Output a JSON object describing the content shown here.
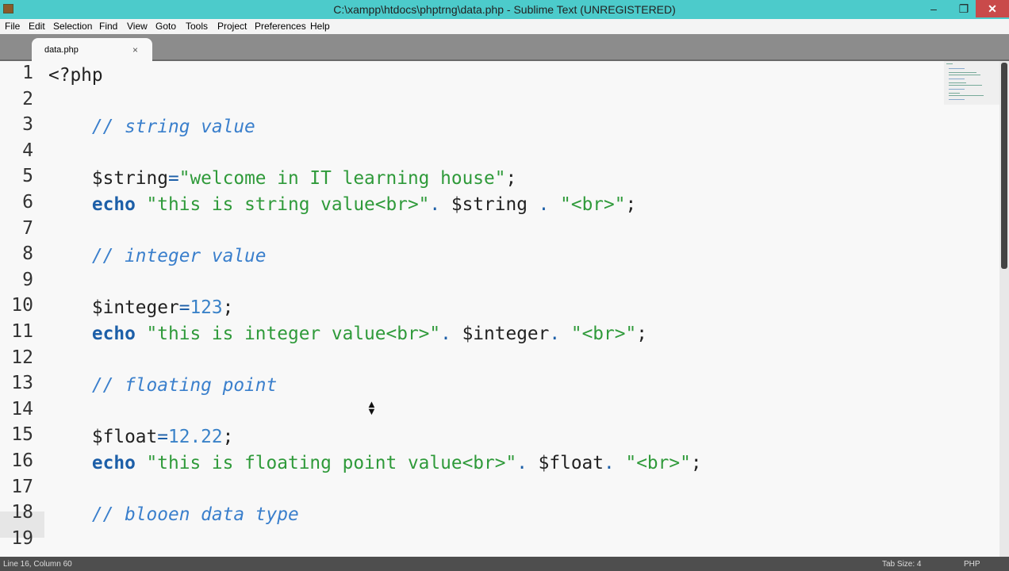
{
  "window": {
    "title": "C:\\xampp\\htdocs\\phptrng\\data.php - Sublime Text (UNREGISTERED)",
    "minimize": "–",
    "restore": "❐",
    "close": "✕"
  },
  "menu": [
    "File",
    "Edit",
    "Selection",
    "Find",
    "View",
    "Goto",
    "Tools",
    "Project",
    "Preferences",
    "Help"
  ],
  "tab": {
    "name": "data.php",
    "close": "×"
  },
  "code": [
    [
      {
        "t": "<?php",
        "c": "plain"
      }
    ],
    [],
    [
      {
        "t": "    ",
        "c": "plain"
      },
      {
        "t": "// string value",
        "c": "com"
      }
    ],
    [],
    [
      {
        "t": "    ",
        "c": "plain"
      },
      {
        "t": "$string",
        "c": "var"
      },
      {
        "t": "=",
        "c": "op"
      },
      {
        "t": "\"welcome in IT learning house\"",
        "c": "str"
      },
      {
        "t": ";",
        "c": "plain"
      }
    ],
    [
      {
        "t": "    ",
        "c": "plain"
      },
      {
        "t": "echo",
        "c": "kw"
      },
      {
        "t": " ",
        "c": "plain"
      },
      {
        "t": "\"this is string value<br>\"",
        "c": "str"
      },
      {
        "t": ". ",
        "c": "op"
      },
      {
        "t": "$string",
        "c": "var"
      },
      {
        "t": " . ",
        "c": "op"
      },
      {
        "t": "\"<br>\"",
        "c": "str"
      },
      {
        "t": ";",
        "c": "plain"
      }
    ],
    [],
    [
      {
        "t": "    ",
        "c": "plain"
      },
      {
        "t": "// integer value",
        "c": "com"
      }
    ],
    [],
    [
      {
        "t": "    ",
        "c": "plain"
      },
      {
        "t": "$integer",
        "c": "var"
      },
      {
        "t": "=",
        "c": "op"
      },
      {
        "t": "123",
        "c": "num"
      },
      {
        "t": ";",
        "c": "plain"
      }
    ],
    [
      {
        "t": "    ",
        "c": "plain"
      },
      {
        "t": "echo",
        "c": "kw"
      },
      {
        "t": " ",
        "c": "plain"
      },
      {
        "t": "\"this is integer value<br>\"",
        "c": "str"
      },
      {
        "t": ". ",
        "c": "op"
      },
      {
        "t": "$integer",
        "c": "var"
      },
      {
        "t": ". ",
        "c": "op"
      },
      {
        "t": "\"<br>\"",
        "c": "str"
      },
      {
        "t": ";",
        "c": "plain"
      }
    ],
    [],
    [
      {
        "t": "    ",
        "c": "plain"
      },
      {
        "t": "// floating point",
        "c": "com"
      }
    ],
    [],
    [
      {
        "t": "    ",
        "c": "plain"
      },
      {
        "t": "$float",
        "c": "var"
      },
      {
        "t": "=",
        "c": "op"
      },
      {
        "t": "12.22",
        "c": "num"
      },
      {
        "t": ";",
        "c": "plain"
      }
    ],
    [
      {
        "t": "    ",
        "c": "plain"
      },
      {
        "t": "echo",
        "c": "kw"
      },
      {
        "t": " ",
        "c": "plain"
      },
      {
        "t": "\"this is floating point value<br>\"",
        "c": "str"
      },
      {
        "t": ". ",
        "c": "op"
      },
      {
        "t": "$float",
        "c": "var"
      },
      {
        "t": ". ",
        "c": "op"
      },
      {
        "t": "\"<br>\"",
        "c": "str"
      },
      {
        "t": ";",
        "c": "plain"
      }
    ],
    [],
    [
      {
        "t": "    ",
        "c": "plain"
      },
      {
        "t": "// blooen data type",
        "c": "com"
      }
    ],
    []
  ],
  "line_numbers": [
    "1",
    "2",
    "3",
    "4",
    "5",
    "6",
    "7",
    "8",
    "9",
    "10",
    "11",
    "12",
    "13",
    "14",
    "15",
    "16",
    "17",
    "18",
    "19"
  ],
  "status": {
    "position": "Line 16, Column 60",
    "tab_size": "Tab Size: 4",
    "syntax": "PHP"
  }
}
